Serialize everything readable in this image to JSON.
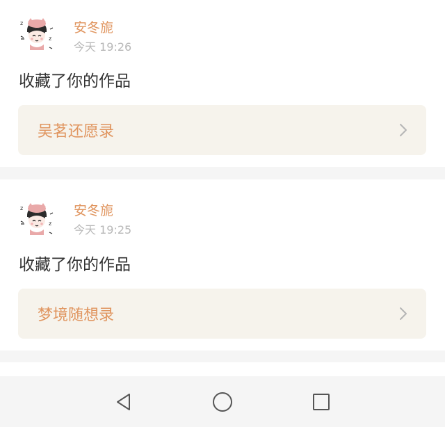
{
  "notifications": [
    {
      "user": "安冬旎",
      "time": "今天 19:26",
      "action": "收藏了你的作品",
      "work_title": "吴茗还愿录",
      "avatar_icon": "cartoon-girl-avatar-icon"
    },
    {
      "user": "安冬旎",
      "time": "今天 19:25",
      "action": "收藏了你的作品",
      "work_title": "梦境随想录",
      "avatar_icon": "cartoon-girl-avatar-icon"
    }
  ],
  "colors": {
    "accent": "#e0955f",
    "page_bg": "#f5f5f5",
    "card_bg": "#ffffff",
    "work_box_bg": "#f6f3ec",
    "time_text": "#b8b8b8",
    "body_text": "#333333"
  },
  "nav_bar": {
    "icons": [
      "back-triangle-icon",
      "home-circle-icon",
      "recent-apps-square-icon"
    ]
  }
}
